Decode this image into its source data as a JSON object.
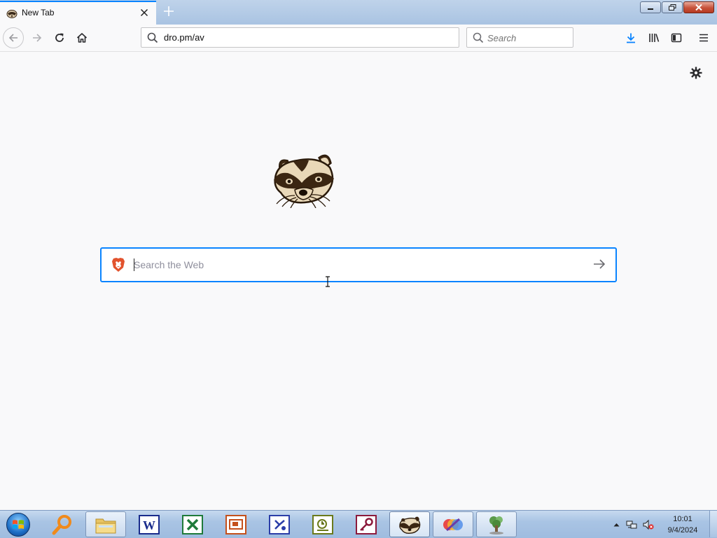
{
  "browser": {
    "tab": {
      "title": "New Tab"
    },
    "url": "dro.pm/av",
    "search_placeholder": "Search"
  },
  "newtab": {
    "search_placeholder": "Search the Web"
  },
  "taskbar": {
    "clock_time": "10:01",
    "clock_date": "9/4/2024",
    "apps": [
      "search-app",
      "file-explorer",
      "word",
      "excel",
      "powerpoint",
      "visio",
      "project",
      "access",
      "browser",
      "paint",
      "tree-app"
    ]
  },
  "colors": {
    "accent": "#0a84ff",
    "page_bg": "#f9f9fa",
    "taskbar": "#a9c4e4"
  },
  "icons": [
    "raccoon-favicon-icon",
    "close-icon",
    "plus-icon",
    "back-icon",
    "forward-icon",
    "reload-icon",
    "home-icon",
    "search-icon",
    "download-icon",
    "library-icon",
    "sidebar-icon",
    "menu-icon",
    "gear-icon",
    "brave-lion-icon",
    "arrow-right-icon"
  ]
}
